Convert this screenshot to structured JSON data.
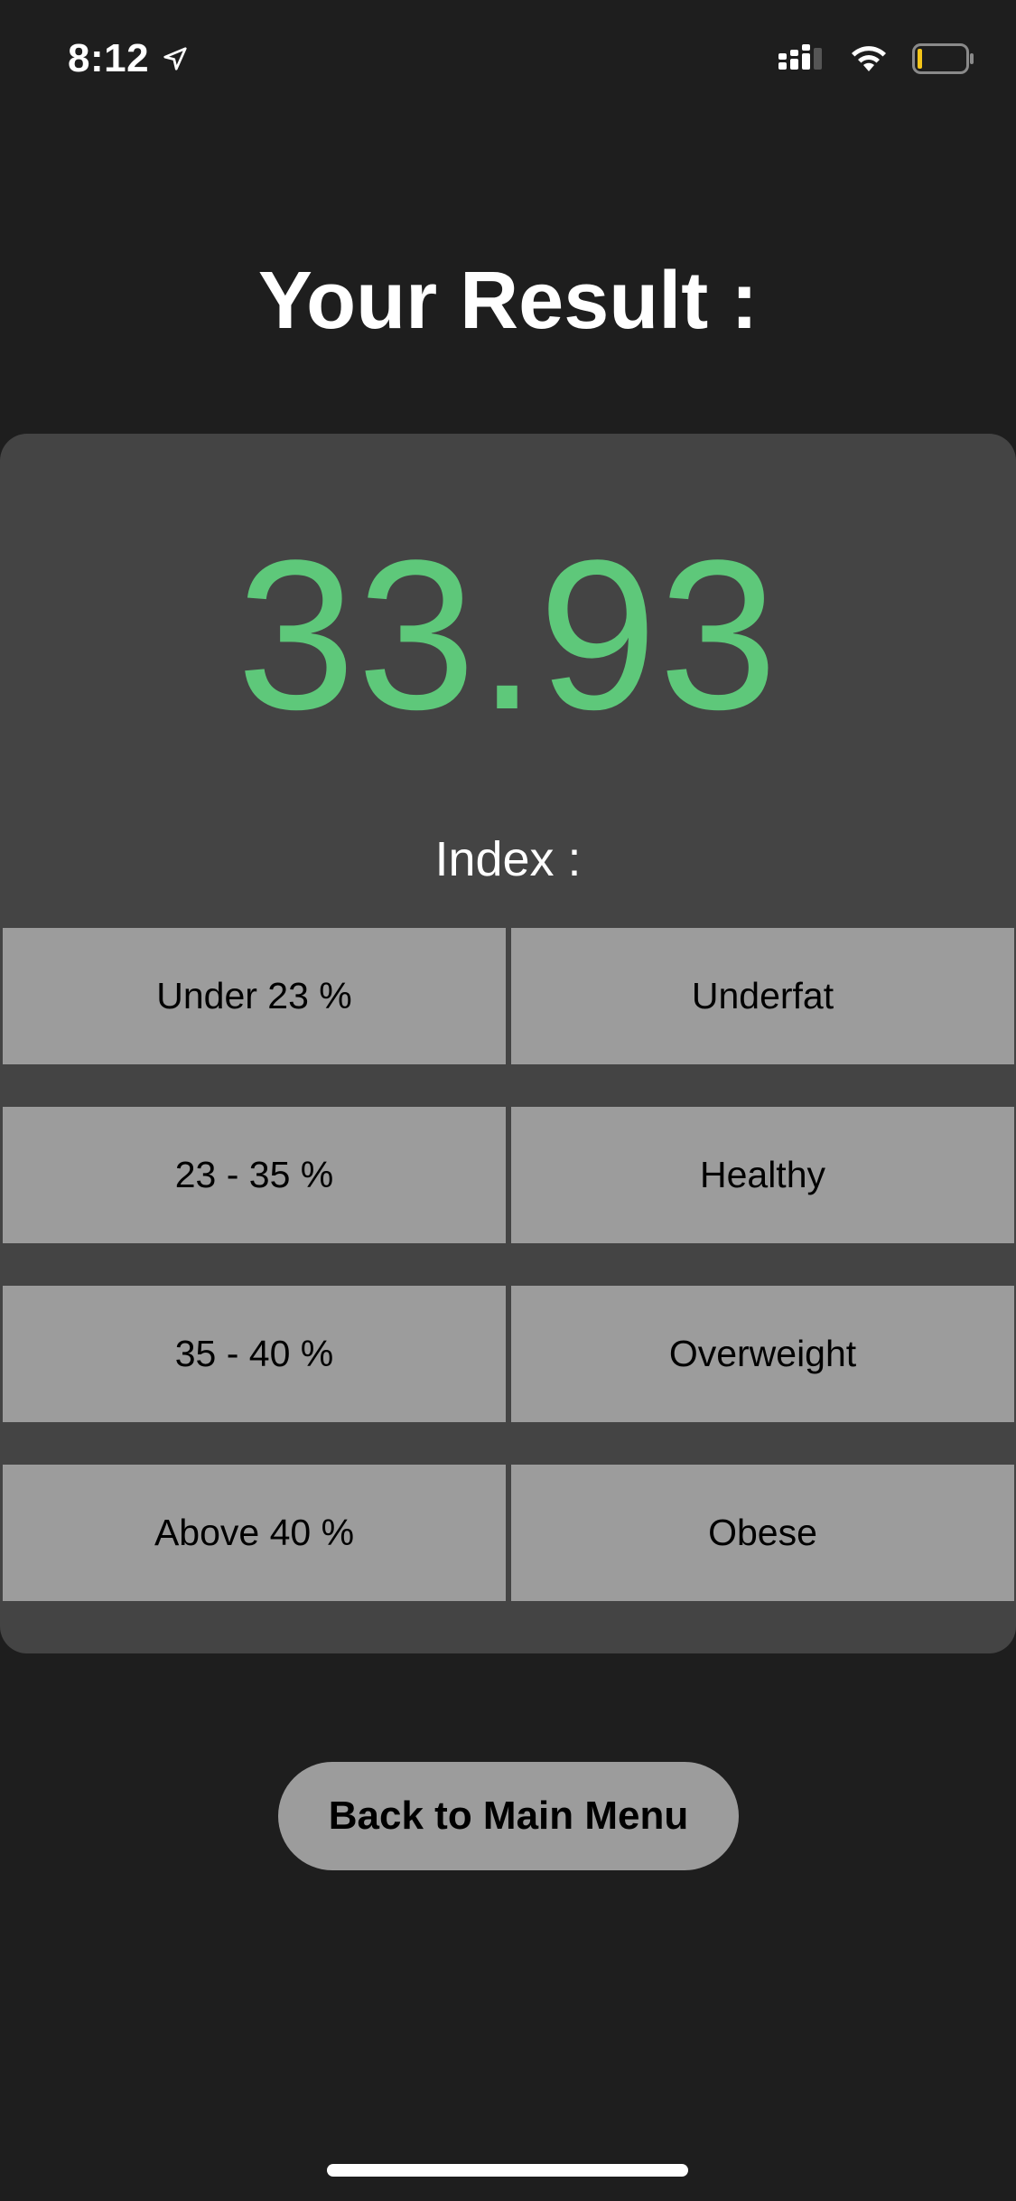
{
  "status_bar": {
    "time": "8:12",
    "location_icon": "location-arrow-icon",
    "signal_icon": "cellular-signal-icon",
    "wifi_icon": "wifi-icon",
    "battery_icon": "battery-low-icon",
    "battery_level": 0.08
  },
  "title": "Your Result :",
  "result": {
    "value": "33.93",
    "color": "#5ec87a"
  },
  "index": {
    "label": "Index :",
    "rows": [
      {
        "range": "Under 23 %",
        "category": "Underfat"
      },
      {
        "range": "23 - 35 %",
        "category": "Healthy"
      },
      {
        "range": "35 - 40 %",
        "category": "Overweight"
      },
      {
        "range": "Above 40 %",
        "category": "Obese"
      }
    ]
  },
  "back_button": {
    "label": "Back to Main Menu"
  },
  "colors": {
    "background": "#1e1e1e",
    "card": "#444444",
    "cell": "#9c9c9c",
    "accent_green": "#5ec87a",
    "battery_warning": "#f5c518"
  }
}
